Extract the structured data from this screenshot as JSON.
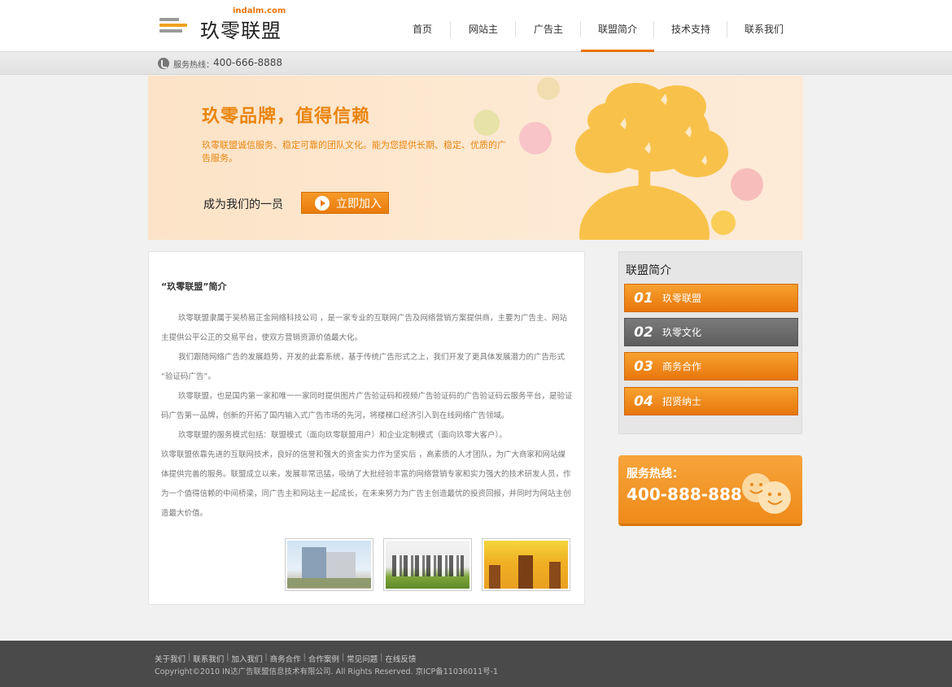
{
  "header": {
    "logo_domain": "indalm.com",
    "logo_name": "玖零联盟",
    "nav": [
      {
        "label": "首页",
        "active": false
      },
      {
        "label": "网站主",
        "active": false
      },
      {
        "label": "广告主",
        "active": false
      },
      {
        "label": "联盟简介",
        "active": true
      },
      {
        "label": "技术支持",
        "active": false
      },
      {
        "label": "联系我们",
        "active": false
      }
    ]
  },
  "hotline_bar": {
    "label": "服务热线：",
    "number": "400-666-8888"
  },
  "banner": {
    "title": "玖零品牌，值得信赖",
    "description": "玖零联盟诚信服务、稳定可靠的团队文化。能为您提供长期、稳定、优质的广告服务。",
    "cta_text": "成为我们的一员",
    "join_button": "立即加入"
  },
  "content": {
    "title": "“玖零联盟”简介",
    "paragraphs": [
      "玖零联盟隶属于吴桥易正金网络科技公司 ，是一家专业的互联网广告及网络营销方案提供商，主要为广告主、网站主提供公平公正的交易平台，使双方营销资源价值最大化。",
      "我们跟随网络广告的发展趋势，开发的此套系统，基于传统广告形式之上，我们开发了更具体发展潜力的广告形式 “验证码广告”。",
      "玖零联盟，也是国内第一家和唯一一家同时提供图片广告验证码和视频广告验证码的广告验证码云服务平台，是验证码广告第一品牌，创新的开拓了国内输入式广告市场的先河，将楼梯口经济引入到在线网络广告领域。",
      "玖零联盟的服务模式包括：联盟模式（面向玖零联盟用户）和企业定制模式（面向玖零大客户）。",
      "玖零联盟依靠先进的互联网技术，良好的信誉和强大的资金实力作为坚实后 ，高素质的人才团队，为广大商家和网站媒体提供完善的服务。联盟成立以来，发展非常迅猛，吸纳了大批经验丰富的网络营销专家和实力强大的技术研发人员，作为一个值得信赖的中间桥梁，同广告主和网站主一起成长，在未来努力为广告主创造最优的投资回报，并同时为网站主创造最大价值。"
    ]
  },
  "sidebar": {
    "title": "联盟简介",
    "items": [
      {
        "num": "01",
        "label": "玖零联盟",
        "color": "#e8760c"
      },
      {
        "num": "02",
        "label": "玖零文化",
        "color": "#666666"
      },
      {
        "num": "03",
        "label": "商务合作",
        "color": "#e8760c"
      },
      {
        "num": "04",
        "label": "招贤纳士",
        "color": "#e8760c"
      }
    ]
  },
  "service": {
    "label": "服务热线：",
    "number": "400-888-888"
  },
  "footer": {
    "links": [
      "关于我们",
      "联系我们",
      "加入我们",
      "商务合作",
      "合作案例",
      "常见问题",
      "在线反馈"
    ],
    "copyright": "Copyright©2010 IN达广告联盟信息技术有限公司. All Rights Reserved. 京ICP备11036011号-1"
  },
  "colors": {
    "accent": "#e8760c",
    "banner_text": "#e9850f",
    "footer_bg": "#4a4a4a"
  }
}
